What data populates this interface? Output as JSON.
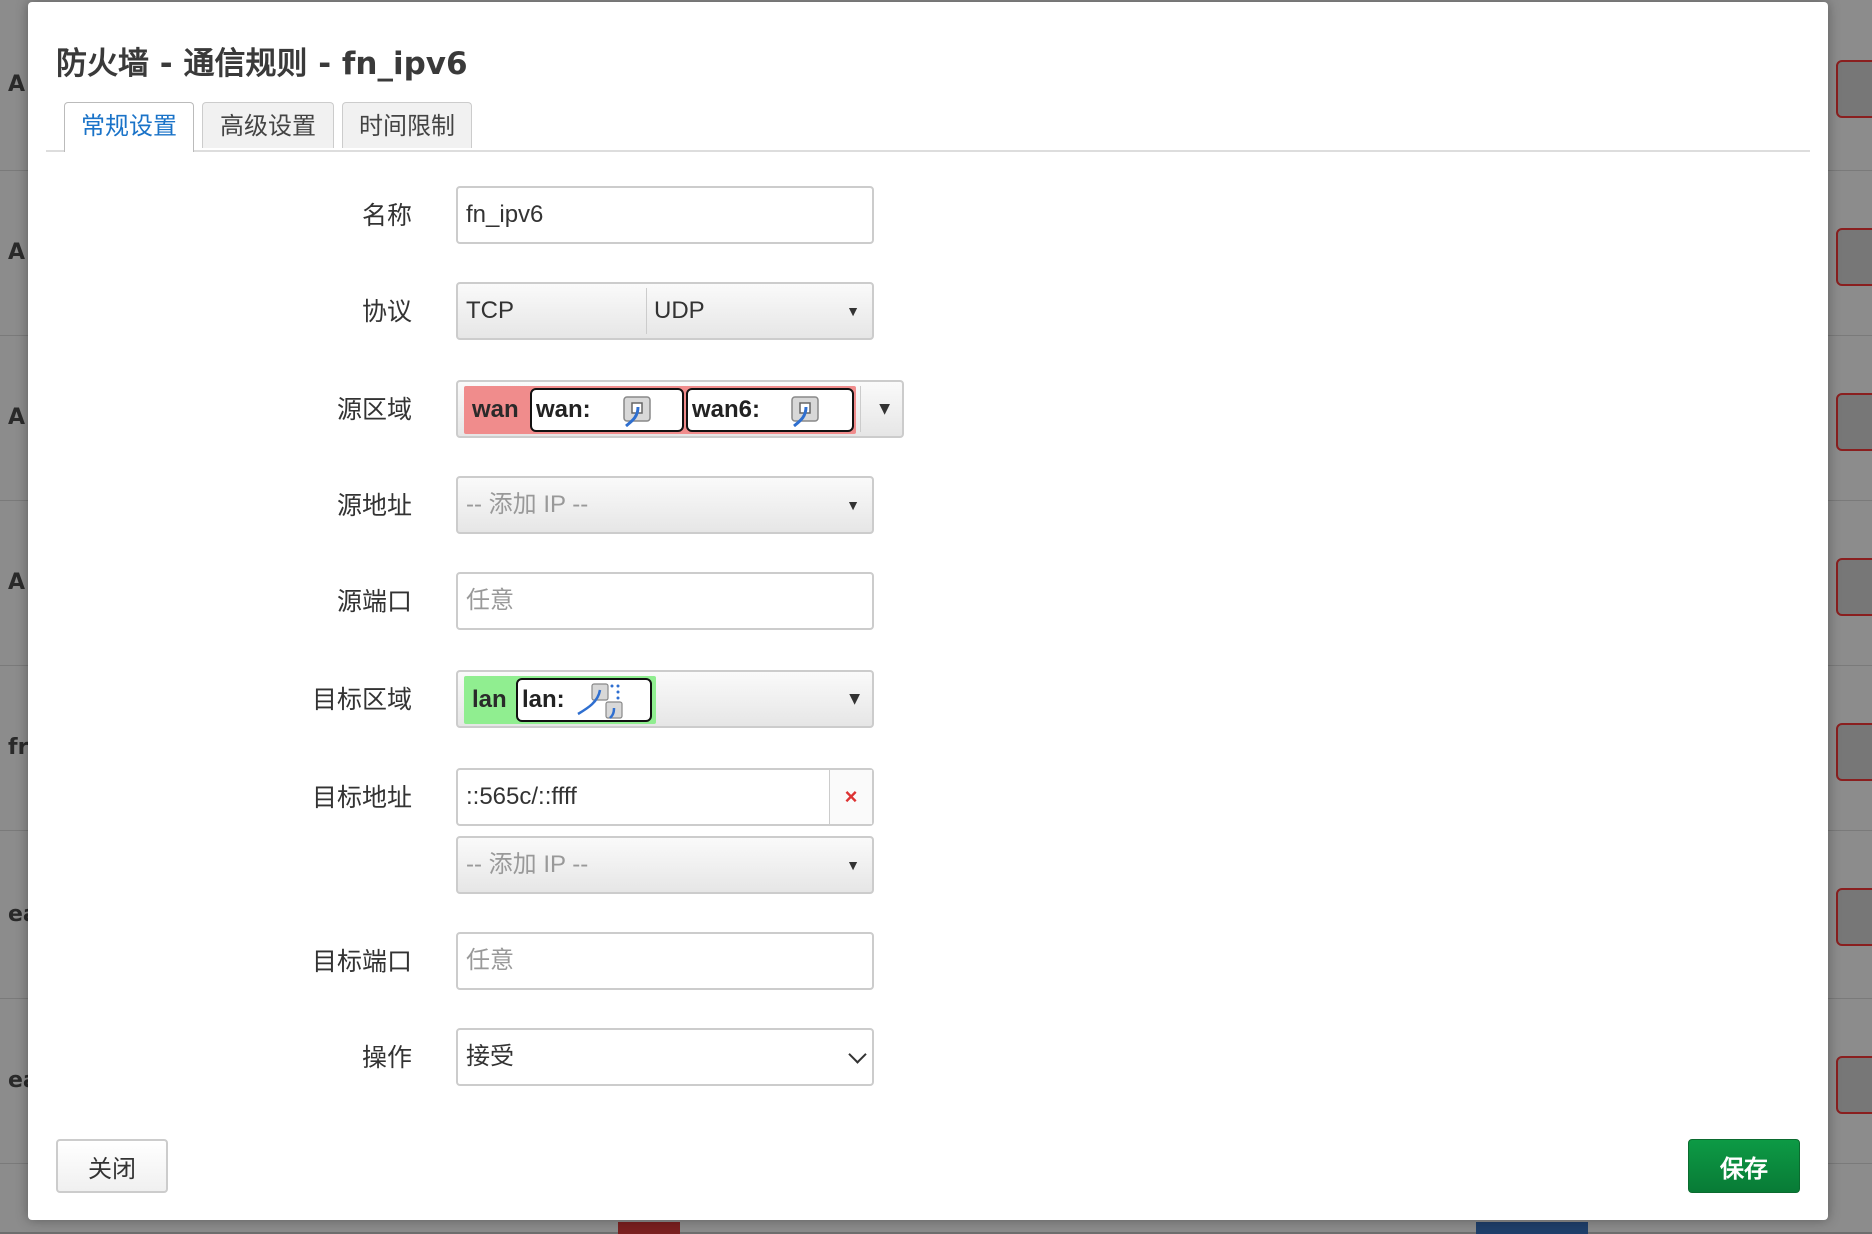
{
  "background": {
    "row_labels": [
      "A",
      "A",
      "A",
      "A",
      "fr",
      "ea",
      "ea"
    ]
  },
  "modal": {
    "title": "防火墙 - 通信规则 - fn_ipv6",
    "tabs": [
      {
        "label": "常规设置",
        "active": true
      },
      {
        "label": "高级设置",
        "active": false
      },
      {
        "label": "时间限制",
        "active": false
      }
    ],
    "fields": {
      "name": {
        "label": "名称",
        "value": "fn_ipv6"
      },
      "protocol": {
        "label": "协议",
        "values": [
          "TCP",
          "UDP"
        ]
      },
      "source_zone": {
        "label": "源区域",
        "zone": "wan",
        "zone_color": "#f08c8c",
        "networks": [
          "wan:",
          "wan6:"
        ]
      },
      "source_address": {
        "label": "源地址",
        "placeholder": "-- 添加 IP --"
      },
      "source_port": {
        "label": "源端口",
        "placeholder": "任意"
      },
      "dest_zone": {
        "label": "目标区域",
        "zone": "lan",
        "zone_color": "#90ee90",
        "networks": [
          "lan:"
        ]
      },
      "dest_address": {
        "label": "目标地址",
        "value": "::565c/::ffff",
        "remove_symbol": "×",
        "add_placeholder": "-- 添加 IP --"
      },
      "dest_port": {
        "label": "目标端口",
        "placeholder": "任意"
      },
      "action": {
        "label": "操作",
        "value": "接受"
      }
    },
    "buttons": {
      "close": "关闭",
      "save": "保存"
    }
  },
  "colors": {
    "save_button": "#0a8a3d",
    "active_tab": "#1a73c8"
  }
}
